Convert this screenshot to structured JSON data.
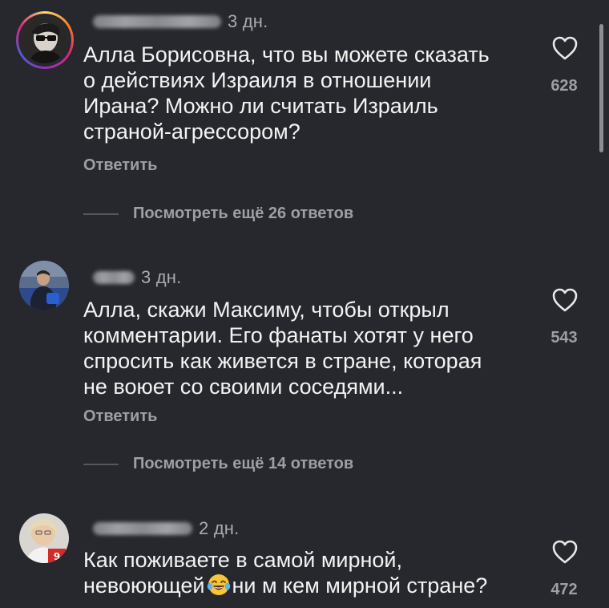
{
  "comments": [
    {
      "time": "3 дн.",
      "text": "Алла Борисовна, что вы можете сказать\nо действиях Израиля в отношении\nИрана? Можно ли считать Израиль\nстраной-агрессором?",
      "reply_label": "Ответить",
      "more_replies": "Посмотреть ещё 26 ответов",
      "likes": "628",
      "avatar_icon": "profile-avatar-icon"
    },
    {
      "time": "3 дн.",
      "text": "Алла, скажи Максиму, чтобы открыл\nкомментарии. Его фанаты хотят у него\nспросить как живется в стране, которая\nне воюет со своими соседями...",
      "reply_label": "Ответить",
      "more_replies": "Посмотреть ещё 14 ответов",
      "likes": "543",
      "avatar_icon": "profile-avatar-icon"
    },
    {
      "time": "2 дн.",
      "text_line1": "Как поживаете в самой мирной,",
      "text_line2_before": "невоюющей",
      "text_line2_after": "ни м кем мирной стране?",
      "emoji_icon": "laughing-tears-emoji-icon",
      "likes": "472",
      "avatar_icon": "profile-avatar-icon"
    }
  ],
  "icons": {
    "like": "heart-outline-icon"
  },
  "colors": {
    "background": "#26282d",
    "text": "#f3f3f3",
    "muted": "#9d9fa4"
  }
}
